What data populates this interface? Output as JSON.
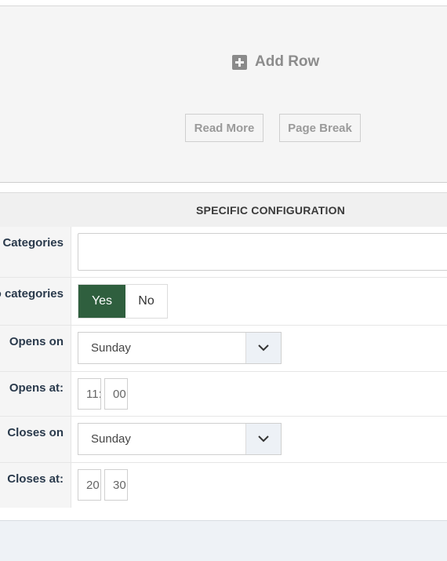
{
  "editor": {
    "add_row_label": "Add Row",
    "read_more_label": "Read More",
    "page_break_label": "Page Break"
  },
  "config": {
    "header": "SPECIFIC CONFIGURATION",
    "rows": [
      {
        "label": "Categories",
        "value": ""
      },
      {
        "label": "o categories",
        "yes": "Yes",
        "no": "No",
        "selected": "Yes"
      },
      {
        "label": "Opens on",
        "value": "Sunday"
      },
      {
        "label": "Opens at:",
        "hour": "11:",
        "minute": "00"
      },
      {
        "label": "Closes on",
        "value": "Sunday"
      },
      {
        "label": "Closes at:",
        "hour": "20:",
        "minute": "30"
      }
    ]
  },
  "colors": {
    "toggle_active": "#2f5f3e",
    "label_text": "#2a3a4c",
    "chevron_bg": "#edf1f6"
  }
}
